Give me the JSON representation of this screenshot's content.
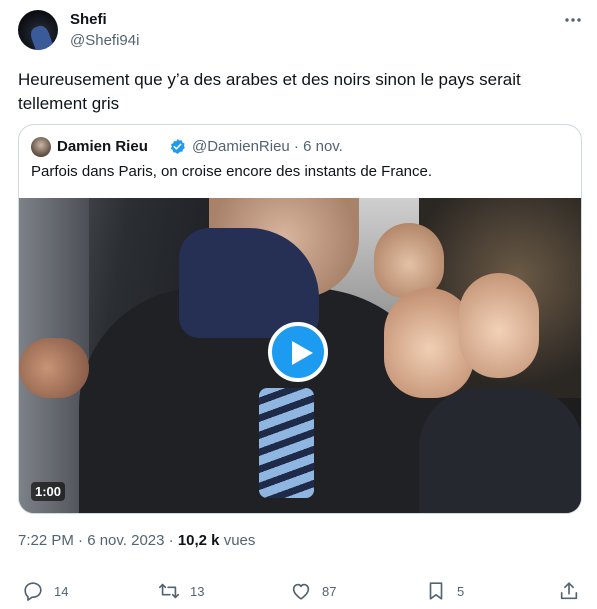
{
  "author": {
    "display_name": "Shefi",
    "handle": "@Shefi94i"
  },
  "tweet": {
    "text": "Heureusement que y’a des arabes et des noirs sinon le pays serait tellement gris"
  },
  "quoted": {
    "display_name": "Damien Rieu",
    "handle_date": "@DamienRieu · 6 nov.",
    "text": "Parfois dans Paris, on croise encore des instants de France.",
    "video_duration": "1:00"
  },
  "meta": {
    "time_date": "7:22 PM · 6 nov. 2023 · ",
    "views_count": "10,2 k",
    "views_label": " vues"
  },
  "actions": {
    "replies": "14",
    "retweets": "13",
    "likes": "87",
    "bookmarks": "5"
  },
  "colors": {
    "accent": "#1d9bf0",
    "secondary_text": "#536471",
    "border": "#cfd9de"
  }
}
